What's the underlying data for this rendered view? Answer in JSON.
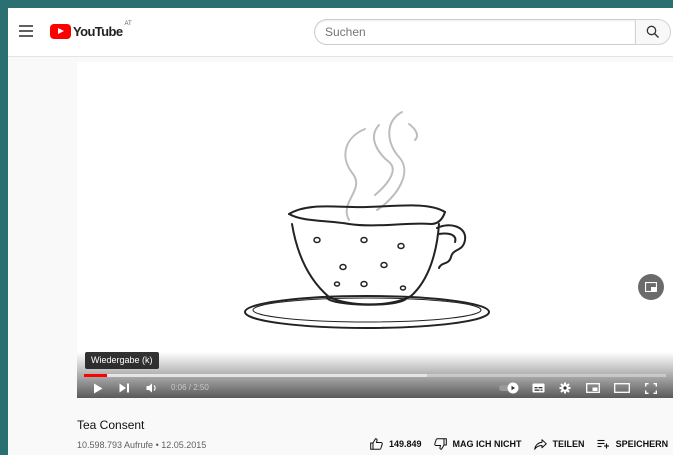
{
  "app": {
    "logo_text": "YouTube",
    "region_code": "AT"
  },
  "search": {
    "placeholder": "Suchen"
  },
  "player": {
    "tooltip": "Wiedergabe (k)",
    "time_display": "0:06 / 2:50",
    "progress_played_fraction": 0.04,
    "progress_buffered_fraction": 0.59,
    "icons": [
      "play-icon",
      "next-icon",
      "volume-icon",
      "autoplay-toggle-icon",
      "subtitles-icon",
      "settings-icon",
      "miniplayer-icon",
      "theater-mode-icon",
      "fullscreen-icon",
      "pip-icon"
    ]
  },
  "video": {
    "title": "Tea Consent",
    "meta": "10.598.793 Aufrufe • 12.05.2015"
  },
  "actions": {
    "like_count": "149.849",
    "dislike_label": "MAG ICH NICHT",
    "share_label": "TEILEN",
    "save_label": "SPEICHERN",
    "more_label": "..."
  },
  "colors": {
    "accent": "#ff0000",
    "background": "#f9f9f9",
    "outer_border": "#2a6f72"
  }
}
